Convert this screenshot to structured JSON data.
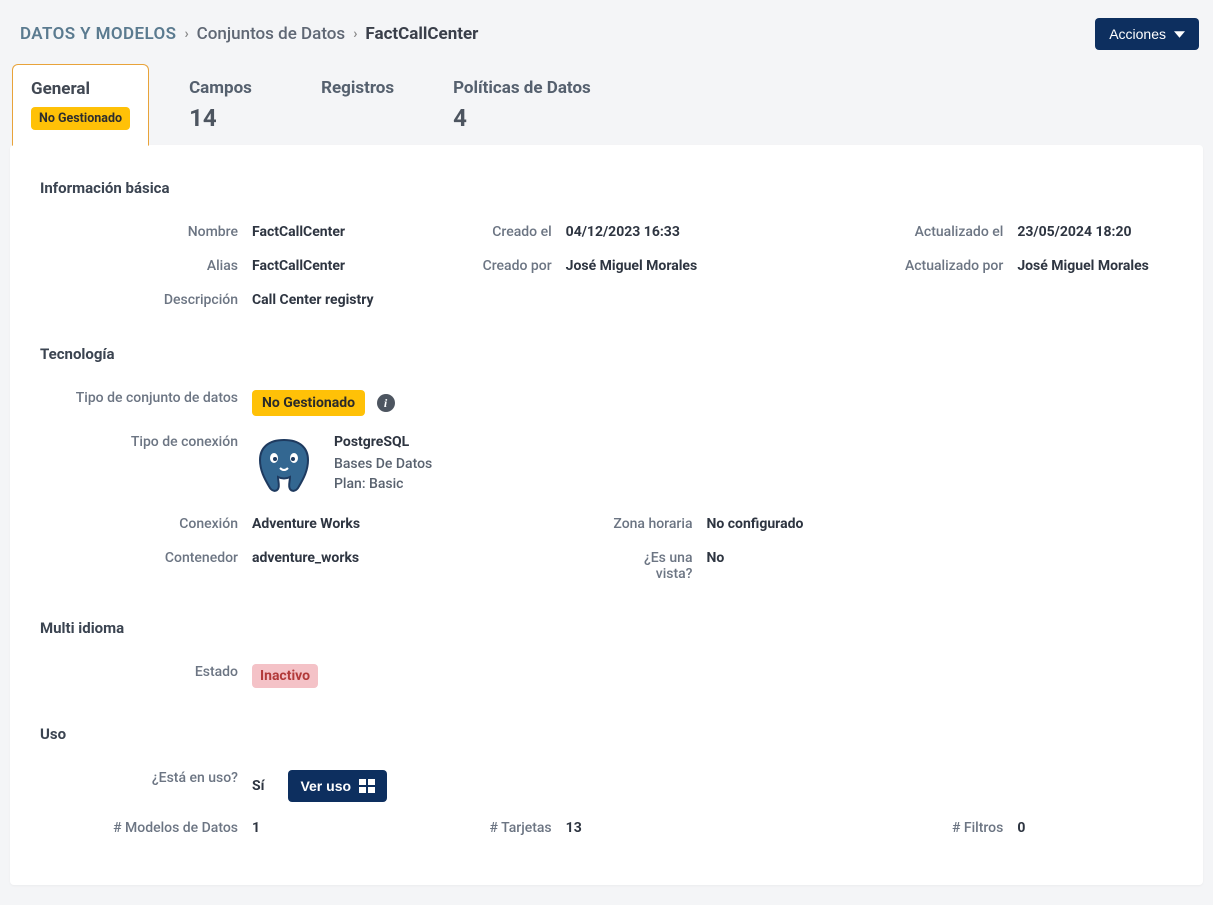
{
  "breadcrumb": {
    "root": "DATOS Y MODELOS",
    "parent": "Conjuntos de Datos",
    "current": "FactCallCenter"
  },
  "actions_button": "Acciones",
  "tabs": {
    "general": {
      "label": "General",
      "badge": "No Gestionado"
    },
    "fields": {
      "label": "Campos",
      "count": "14"
    },
    "records": {
      "label": "Registros"
    },
    "policies": {
      "label": "Políticas de Datos",
      "count": "4"
    }
  },
  "sections": {
    "basic": {
      "title": "Información básica",
      "name_label": "Nombre",
      "name_value": "FactCallCenter",
      "created_label": "Creado el",
      "created_value": "04/12/2023 16:33",
      "updated_label": "Actualizado el",
      "updated_value": "23/05/2024 18:20",
      "alias_label": "Alias",
      "alias_value": "FactCallCenter",
      "createdby_label": "Creado por",
      "createdby_value": "José Miguel Morales",
      "updatedby_label": "Actualizado por",
      "updatedby_value": "José Miguel Morales",
      "desc_label": "Descripción",
      "desc_value": "Call Center registry"
    },
    "tech": {
      "title": "Tecnología",
      "dstype_label": "Tipo de conjunto de datos",
      "dstype_badge": "No Gestionado",
      "ctype_label": "Tipo de conexión",
      "ctype_name": "PostgreSQL",
      "ctype_category": "Bases De Datos",
      "ctype_plan": "Plan: Basic",
      "conn_label": "Conexión",
      "conn_value": "Adventure Works",
      "tz_label": "Zona horaria",
      "tz_value": "No configurado",
      "container_label": "Contenedor",
      "container_value": "adventure_works",
      "isview_label": "¿Es una vista?",
      "isview_value": "No"
    },
    "multilang": {
      "title": "Multi idioma",
      "state_label": "Estado",
      "state_value": "Inactivo"
    },
    "usage": {
      "title": "Uso",
      "inuse_label": "¿Está en uso?",
      "inuse_value": "Sí",
      "ver_uso_btn": "Ver uso",
      "models_label": "# Modelos de Datos",
      "models_value": "1",
      "cards_label": "# Tarjetas",
      "cards_value": "13",
      "filters_label": "# Filtros",
      "filters_value": "0"
    }
  }
}
